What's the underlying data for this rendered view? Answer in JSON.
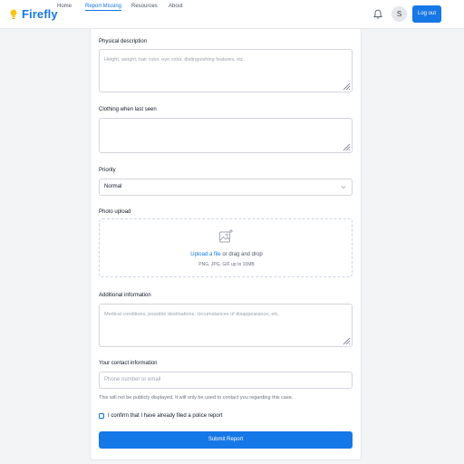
{
  "app": {
    "name": "Firefly"
  },
  "nav": {
    "links": [
      "Home",
      "Report Missing",
      "Resources",
      "About"
    ]
  },
  "user": {
    "avatar_initial": "S"
  },
  "header": {
    "logout_label": "Log out"
  },
  "form": {
    "physical_description": {
      "label": "Physical description",
      "placeholder": "Height, weight, hair color, eye color, distinguishing features, etc."
    },
    "clothing": {
      "label": "Clothing when last seen",
      "placeholder": ""
    },
    "priority": {
      "label": "Priority",
      "value": "Normal"
    },
    "photo": {
      "label": "Photo upload",
      "upload_link": "Upload a file",
      "upload_rest": " or drag and drop",
      "hint": "PNG, JPG, GIF up to 10MB"
    },
    "additional": {
      "label": "Additional information",
      "placeholder": "Medical conditions, possible destinations, circumstances of disappearance, etc."
    },
    "contact": {
      "label": "Your contact information",
      "placeholder": "Phone number or email",
      "helper": "This will not be publicly displayed. It will only be used to contact you regarding this case."
    },
    "police_confirm": {
      "label": "I confirm that I have already filed a police report",
      "checked": false
    },
    "submit_label": "Submit Report"
  },
  "colors": {
    "accent": "#1677e6",
    "brand_icon": "#f5c518"
  },
  "icons": {
    "brand": "lightbulb-icon",
    "bell": "bell-icon",
    "upload": "image-add-icon",
    "select": "chevron-down-icon",
    "resize": "resize-handle-icon"
  }
}
